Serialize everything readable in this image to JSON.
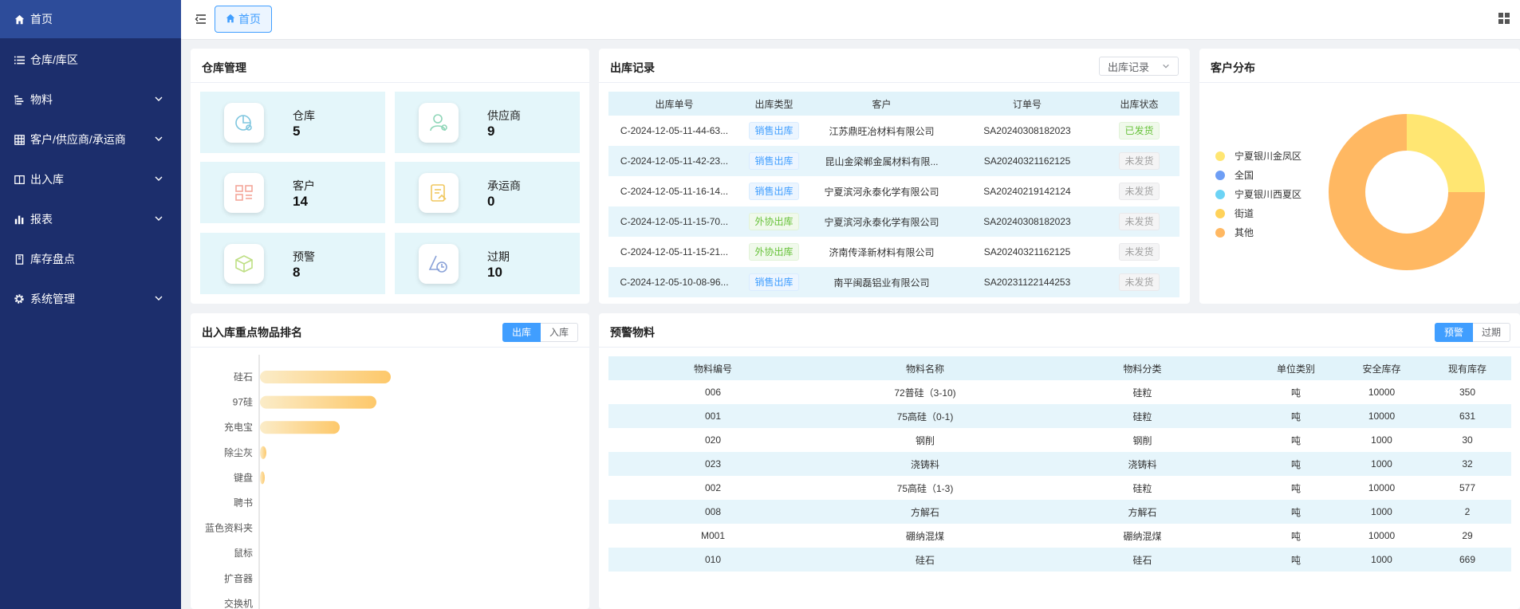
{
  "sidebar": {
    "items": [
      {
        "label": "首页",
        "icon": "home-icon"
      },
      {
        "label": "仓库/库区",
        "icon": "list-icon"
      },
      {
        "label": "物料",
        "icon": "tree-icon"
      },
      {
        "label": "客户/供应商/承运商",
        "icon": "grid-icon"
      },
      {
        "label": "出入库",
        "icon": "split-icon"
      },
      {
        "label": "报表",
        "icon": "bar-icon"
      },
      {
        "label": "库存盘点",
        "icon": "book-icon"
      },
      {
        "label": "系统管理",
        "icon": "gear-icon"
      }
    ]
  },
  "header": {
    "tab_label": "首页"
  },
  "warehouse": {
    "title": "仓库管理",
    "stats": [
      {
        "label": "仓库",
        "value": "5"
      },
      {
        "label": "供应商",
        "value": "9"
      },
      {
        "label": "客户",
        "value": "14"
      },
      {
        "label": "承运商",
        "value": "0"
      },
      {
        "label": "预警",
        "value": "8"
      },
      {
        "label": "过期",
        "value": "10"
      }
    ]
  },
  "outbound": {
    "title": "出库记录",
    "select_value": "出库记录",
    "columns": [
      "出库单号",
      "出库类型",
      "客户",
      "订单号",
      "出库状态"
    ],
    "rows": [
      {
        "no": "C-2024-12-05-11-44-63...",
        "type": "销售出库",
        "customer": "江苏鼎旺冶材料有限公司",
        "order": "SA20240308182023",
        "status": "已发货"
      },
      {
        "no": "C-2024-12-05-11-42-23...",
        "type": "销售出库",
        "customer": "昆山金梁郸金属材料有限...",
        "order": "SA20240321162125",
        "status": "未发货"
      },
      {
        "no": "C-2024-12-05-11-16-14...",
        "type": "销售出库",
        "customer": "宁夏滨河永泰化学有限公司",
        "order": "SA20240219142124",
        "status": "未发货"
      },
      {
        "no": "C-2024-12-05-11-15-70...",
        "type": "外协出库",
        "customer": "宁夏滨河永泰化学有限公司",
        "order": "SA20240308182023",
        "status": "未发货"
      },
      {
        "no": "C-2024-12-05-11-15-21...",
        "type": "外协出库",
        "customer": "济南传泽新材料有限公司",
        "order": "SA20240321162125",
        "status": "未发货"
      },
      {
        "no": "C-2024-12-05-10-08-96...",
        "type": "销售出库",
        "customer": "南平闽磊铝业有限公司",
        "order": "SA20231122144253",
        "status": "未发货"
      }
    ]
  },
  "customers": {
    "title": "客户分布",
    "colors": {
      "c1": "#ffe672",
      "c2": "#6e9ef5",
      "c3": "#6cd3f5",
      "c4": "#ffd25a",
      "c5": "#ffb862"
    }
  },
  "ranking": {
    "title": "出入库重点物品排名",
    "btn_out": "出库",
    "btn_in": "入库"
  },
  "chart_data": {
    "type": "bar",
    "orientation": "horizontal",
    "categories": [
      "硅石",
      "97硅",
      "充电宝",
      "除尘灰",
      "键盘",
      "聘书",
      "蓝色资料夹",
      "鼠标",
      "扩音器",
      "交换机"
    ],
    "values": [
      82,
      73,
      50,
      4,
      1,
      0,
      0,
      0,
      0,
      0
    ],
    "xlim": [
      0,
      180
    ]
  },
  "customer_chart": {
    "type": "pie",
    "labels": [
      "宁夏银川金凤区",
      "全国",
      "宁夏银川西夏区",
      "街道",
      "其他"
    ],
    "values": [
      25,
      0,
      0,
      0,
      75
    ]
  },
  "warning": {
    "title": "预警物料",
    "btn_warn": "预警",
    "btn_expire": "过期",
    "columns": [
      "物料编号",
      "物料名称",
      "物料分类",
      "单位类别",
      "安全库存",
      "现有库存"
    ],
    "rows": [
      [
        "006",
        "72普硅（3-10)",
        "硅粒",
        "吨",
        "10000",
        "350"
      ],
      [
        "001",
        "75高硅（0-1)",
        "硅粒",
        "吨",
        "10000",
        "631"
      ],
      [
        "020",
        "钢削",
        "钢削",
        "吨",
        "1000",
        "30"
      ],
      [
        "023",
        "浇铸料",
        "浇铸料",
        "吨",
        "1000",
        "32"
      ],
      [
        "002",
        "75高硅（1-3)",
        "硅粒",
        "吨",
        "10000",
        "577"
      ],
      [
        "008",
        "方解石",
        "方解石",
        "吨",
        "1000",
        "2"
      ],
      [
        "M001",
        "硼纳混煤",
        "硼纳混煤",
        "吨",
        "10000",
        "29"
      ],
      [
        "010",
        "硅石",
        "硅石",
        "吨",
        "1000",
        "669"
      ]
    ]
  }
}
